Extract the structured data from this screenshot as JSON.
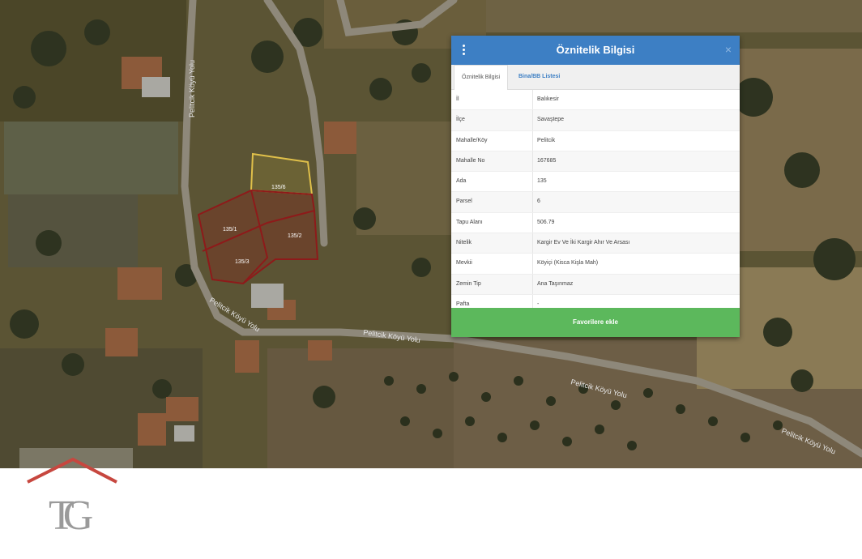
{
  "panel": {
    "title": "Öznitelik Bilgisi",
    "close": "×",
    "tabs": [
      "Öznitelik Bilgisi",
      "Bina/BB Listesi"
    ],
    "rows": [
      {
        "key": "İl",
        "value": "Balıkesir"
      },
      {
        "key": "İlçe",
        "value": "Savaştepe"
      },
      {
        "key": "Mahalle/Köy",
        "value": "Pelitcik"
      },
      {
        "key": "Mahalle No",
        "value": "167685"
      },
      {
        "key": "Ada",
        "value": "135"
      },
      {
        "key": "Parsel",
        "value": "6"
      },
      {
        "key": "Tapu Alanı",
        "value": "506.79"
      },
      {
        "key": "Nitelik",
        "value": "Kargir Ev Ve İki Kargir Ahır Ve Arsası"
      },
      {
        "key": "Mevkii",
        "value": "Köyiçi (Kisca Kişla Mah)"
      },
      {
        "key": "Zemin Tip",
        "value": "Ana Taşınmaz"
      },
      {
        "key": "Pafta",
        "value": "-"
      }
    ],
    "favorite_button": "Favorilere ekle"
  },
  "map": {
    "road_labels": [
      "Pelitcik Köyü Yolu",
      "Pelitcik Köyü Yolu",
      "Pelitcik Köyü Yolu",
      "Pelitcik Köyü Yolu",
      "Pelitcik Köyü Yolu"
    ],
    "parcel_labels": [
      "135/6",
      "135/1",
      "135/2",
      "135/3"
    ]
  },
  "logo": {
    "letters": "TG"
  }
}
